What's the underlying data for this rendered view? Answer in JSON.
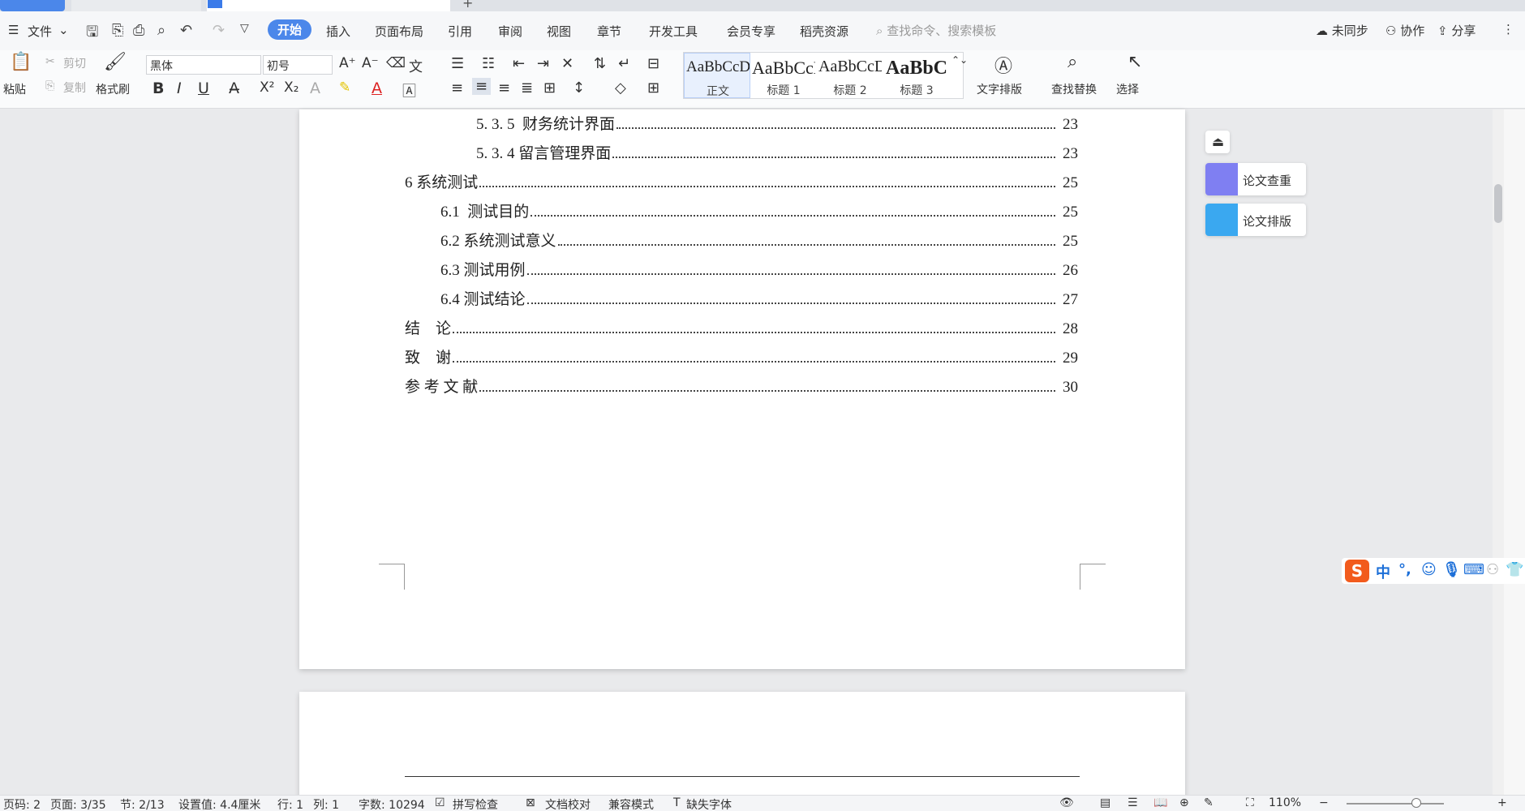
{
  "menu": {
    "file": "文件",
    "tabs": [
      "开始",
      "插入",
      "页面布局",
      "引用",
      "审阅",
      "视图",
      "章节",
      "开发工具",
      "会员专享",
      "稻壳资源"
    ],
    "search_placeholder": "查找命令、搜索模板",
    "unsynced": "未同步",
    "collab": "协作",
    "share": "分享"
  },
  "ribbon": {
    "paste": "粘贴",
    "cut": "剪切",
    "copy": "复制",
    "format_painter": "格式刷",
    "font_name": "黑体",
    "font_size": "初号",
    "styles": [
      {
        "preview": "AaBbCcDd",
        "label": "正文"
      },
      {
        "preview": "AaBbCcD",
        "label": "标题 1"
      },
      {
        "preview": "AaBbCcD",
        "label": "标题 2"
      },
      {
        "preview": "AaBbC",
        "label": "标题 3"
      }
    ],
    "text_layout": "文字排版",
    "find_replace": "查找替换",
    "select": "选择"
  },
  "toc": [
    {
      "title": "5. 3. 5  财务统计界面",
      "page": "23"
    },
    {
      "title": "5. 3. 4 留言管理界面",
      "page": "23"
    },
    {
      "title": "6 系统测试",
      "page": "25"
    },
    {
      "title": "6.1  测试目的",
      "page": "25"
    },
    {
      "title": "6.2 系统测试意义",
      "page": "25"
    },
    {
      "title": "6.3 测试用例",
      "page": "26"
    },
    {
      "title": "6.4 测试结论",
      "page": "27"
    },
    {
      "title": "结    论",
      "page": "28"
    },
    {
      "title": "致    谢",
      "page": "29"
    },
    {
      "title": "参 考 文 献",
      "page": "30"
    }
  ],
  "side_panel": {
    "check": "论文查重",
    "format": "论文排版"
  },
  "ime": {
    "logo": "S",
    "mode": "中"
  },
  "status": {
    "page_no": "页码: 2",
    "pages": "页面: 3/35",
    "section": "节: 2/13",
    "setting": "设置值: 4.4厘米",
    "row": "行: 1",
    "col": "列: 1",
    "words": "字数: 10294",
    "spell": "拼写检查",
    "proof": "文档校对",
    "compat": "兼容模式",
    "missing_font": "缺失字体",
    "zoom": "110%"
  },
  "colors": {
    "accent": "#4b87ea",
    "ime_orange": "#f25b1d",
    "check_icon": "#7f7ff2",
    "format_icon": "#3aa8f0"
  }
}
